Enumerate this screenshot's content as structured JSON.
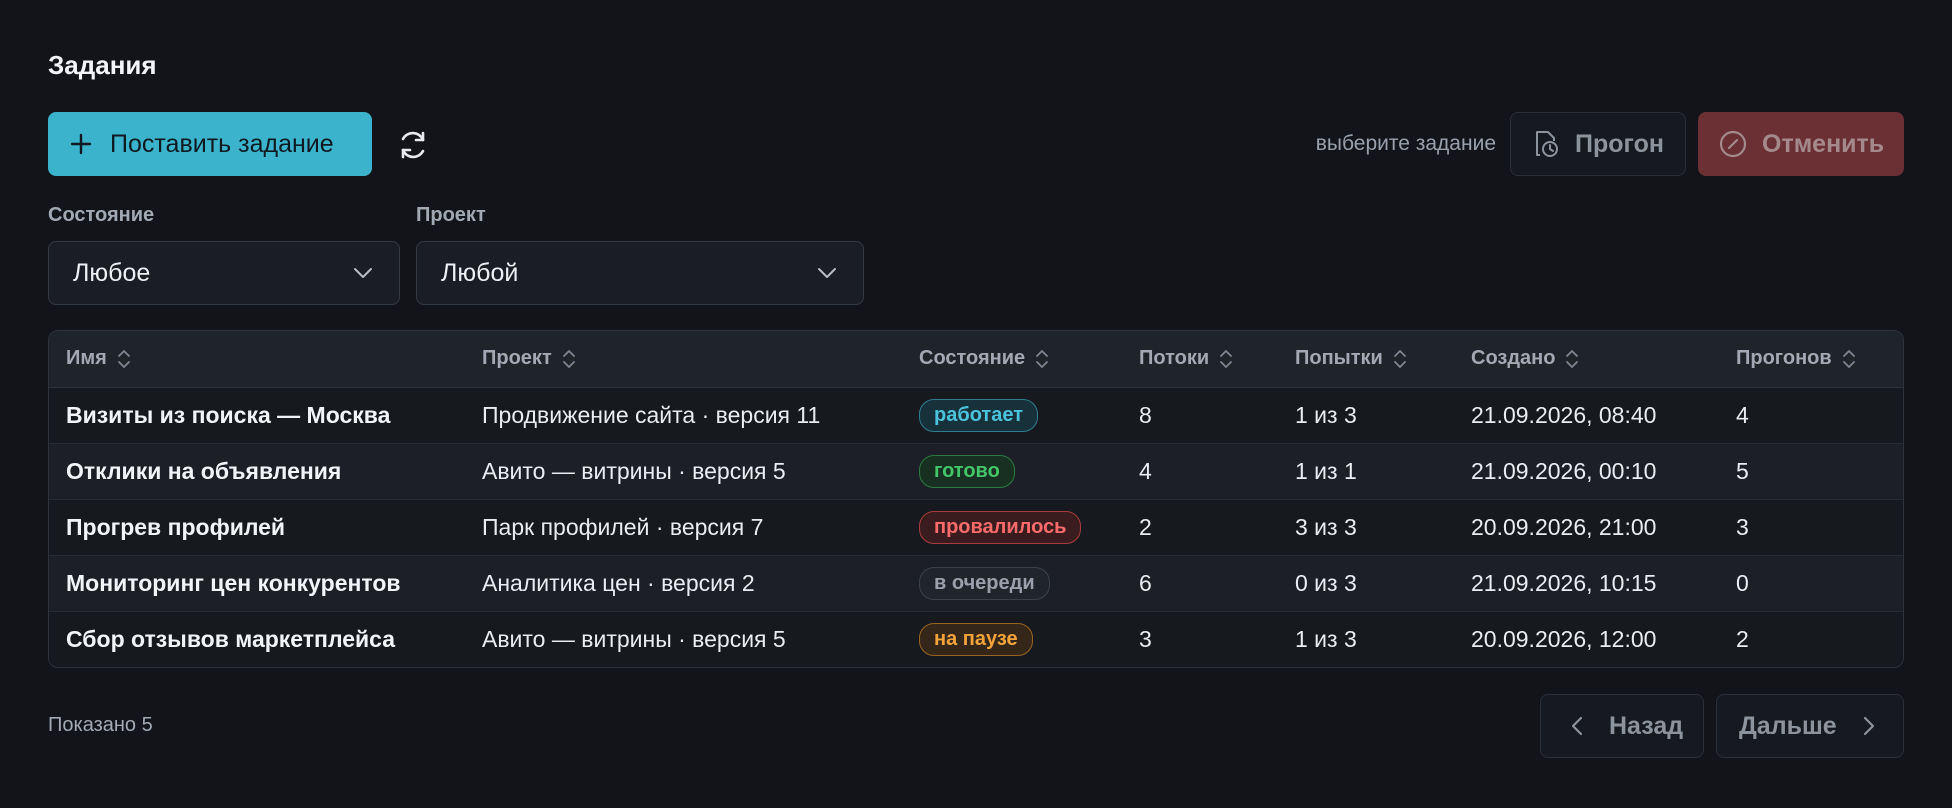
{
  "page": {
    "title": "Задания"
  },
  "toolbar": {
    "create_label": "Поставить задание",
    "hint": "выберите задание",
    "run_label": "Прогон",
    "cancel_label": "Отменить"
  },
  "filters": {
    "state": {
      "label": "Состояние",
      "value": "Любое"
    },
    "project": {
      "label": "Проект",
      "value": "Любой"
    }
  },
  "table": {
    "columns": [
      "Имя",
      "Проект",
      "Состояние",
      "Потоки",
      "Попытки",
      "Создано",
      "Прогонов"
    ],
    "rows": [
      {
        "name": "Визиты из поиска — Москва",
        "project": "Продвижение сайта · версия 11",
        "state": "работает",
        "state_kind": "running",
        "threads": "8",
        "attempts": "1 из 3",
        "created": "21.09.2026, 08:40",
        "runs": "4"
      },
      {
        "name": "Отклики на объявления",
        "project": "Авито — витрины · версия 5",
        "state": "готово",
        "state_kind": "done",
        "threads": "4",
        "attempts": "1 из 1",
        "created": "21.09.2026, 00:10",
        "runs": "5"
      },
      {
        "name": "Прогрев профилей",
        "project": "Парк профилей · версия 7",
        "state": "провалилось",
        "state_kind": "failed",
        "threads": "2",
        "attempts": "3 из 3",
        "created": "20.09.2026, 21:00",
        "runs": "3"
      },
      {
        "name": "Мониторинг цен конкурентов",
        "project": "Аналитика цен · версия 2",
        "state": "в очереди",
        "state_kind": "queued",
        "threads": "6",
        "attempts": "0 из 3",
        "created": "21.09.2026, 10:15",
        "runs": "0"
      },
      {
        "name": "Сбор отзывов маркетплейса",
        "project": "Авито — витрины · версия 5",
        "state": "на паузе",
        "state_kind": "paused",
        "threads": "3",
        "attempts": "1 из 3",
        "created": "20.09.2026, 12:00",
        "runs": "2"
      }
    ]
  },
  "footer": {
    "shown": "Показано 5",
    "prev_label": "Назад",
    "next_label": "Дальше"
  },
  "colors": {
    "accent": "#3bb3cc",
    "danger": "#6a3033",
    "background": "#121419"
  },
  "icons": [
    "plus-icon",
    "refresh-icon",
    "run-clock-icon",
    "cancel-icon",
    "chevron-down-icon",
    "sort-icon",
    "chevron-left-icon",
    "chevron-right-icon"
  ]
}
